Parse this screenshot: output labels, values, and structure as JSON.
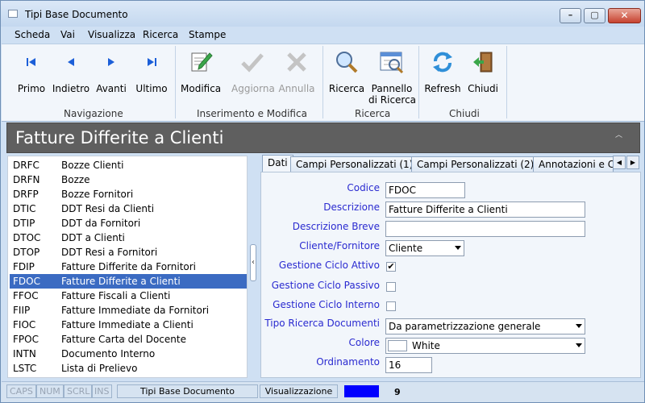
{
  "window": {
    "title": "Tipi Base Documento"
  },
  "menu": [
    "Scheda",
    "Vai",
    "Visualizza",
    "Ricerca",
    "Stampe"
  ],
  "ribbon": {
    "groups": [
      {
        "label": "Navigazione",
        "buttons": [
          {
            "label": "Primo",
            "icon": "first-record-icon"
          },
          {
            "label": "Indietro",
            "icon": "previous-record-icon"
          },
          {
            "label": "Avanti",
            "icon": "next-record-icon"
          },
          {
            "label": "Ultimo",
            "icon": "last-record-icon"
          }
        ]
      },
      {
        "label": "Inserimento e Modifica",
        "buttons": [
          {
            "label": "Modifica",
            "icon": "edit-icon"
          },
          {
            "label": "Aggiorna",
            "icon": "checkmark-icon",
            "disabled": true
          },
          {
            "label": "Annulla",
            "icon": "cancel-x-icon",
            "disabled": true
          }
        ]
      },
      {
        "label": "Ricerca",
        "buttons": [
          {
            "label": "Ricerca",
            "icon": "magnifier-icon"
          },
          {
            "label": "Pannello",
            "label2": "di Ricerca",
            "icon": "search-panel-icon"
          }
        ]
      },
      {
        "label": "Chiudi",
        "buttons": [
          {
            "label": "Refresh",
            "icon": "refresh-icon"
          },
          {
            "label": "Chiudi",
            "icon": "exit-door-icon"
          }
        ]
      }
    ]
  },
  "header": {
    "title": "Fatture Differite a Clienti"
  },
  "list": {
    "rows": [
      {
        "code": "DRFC",
        "desc": "Bozze Clienti"
      },
      {
        "code": "DRFN",
        "desc": "Bozze"
      },
      {
        "code": "DRFP",
        "desc": "Bozze Fornitori"
      },
      {
        "code": "DTIC",
        "desc": "DDT Resi da Clienti"
      },
      {
        "code": "DTIP",
        "desc": "DDT da Fornitori"
      },
      {
        "code": "DTOC",
        "desc": "DDT a Clienti"
      },
      {
        "code": "DTOP",
        "desc": "DDT Resi a Fornitori"
      },
      {
        "code": "FDIP",
        "desc": "Fatture Differite da Fornitori"
      },
      {
        "code": "FDOC",
        "desc": "Fatture Differite a Clienti",
        "selected": true
      },
      {
        "code": "FFOC",
        "desc": "Fatture Fiscali a Clienti"
      },
      {
        "code": "FIIP",
        "desc": "Fatture Immediate da Fornitori"
      },
      {
        "code": "FIOC",
        "desc": "Fatture Immediate a Clienti"
      },
      {
        "code": "FPOC",
        "desc": "Fatture Carta del Docente"
      },
      {
        "code": "INTN",
        "desc": "Documento Interno"
      },
      {
        "code": "LSTC",
        "desc": "Lista di Prelievo"
      }
    ]
  },
  "tabs": [
    "Dati",
    "Campi Personalizzati (1)",
    "Campi Personalizzati (2)",
    "Annotazioni e C"
  ],
  "form": {
    "codice": {
      "label": "Codice",
      "value": "FDOC"
    },
    "descrizione": {
      "label": "Descrizione",
      "value": "Fatture Differite a Clienti"
    },
    "descrizione_breve": {
      "label": "Descrizione Breve",
      "value": ""
    },
    "cliente_fornitore": {
      "label": "Cliente/Fornitore",
      "value": "Cliente"
    },
    "gestione_ciclo_attivo": {
      "label": "Gestione Ciclo Attivo",
      "checked": true
    },
    "gestione_ciclo_passivo": {
      "label": "Gestione Ciclo Passivo",
      "checked": false
    },
    "gestione_ciclo_interno": {
      "label": "Gestione Ciclo Interno",
      "checked": false
    },
    "tipo_ricerca": {
      "label": "Tipo Ricerca Documenti",
      "value": "Da parametrizzazione generale"
    },
    "colore": {
      "label": "Colore",
      "value": "White"
    },
    "ordinamento": {
      "label": "Ordinamento",
      "value": "16"
    }
  },
  "status": {
    "caps": "CAPS",
    "num": "NUM",
    "scrl": "SCRL",
    "ins": "INS",
    "module": "Tipi Base Documento",
    "mode": "Visualizzazione",
    "count": "9",
    "accent": "#0000ff"
  }
}
